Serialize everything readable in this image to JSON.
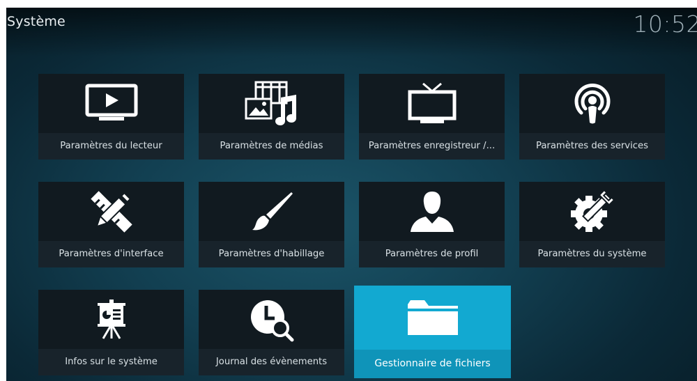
{
  "header": {
    "title": "Système",
    "clock": "10:52"
  },
  "tiles": [
    {
      "label": "Paramètres du lecteur",
      "icon": "monitor-play-icon"
    },
    {
      "label": "Paramètres de médias",
      "icon": "media-icon"
    },
    {
      "label": "Paramètres enregistreur /...",
      "icon": "tv-icon"
    },
    {
      "label": "Paramètres des services",
      "icon": "podcast-icon"
    },
    {
      "label": "Paramètres d'interface",
      "icon": "pencil-ruler-icon"
    },
    {
      "label": "Paramètres d'habillage",
      "icon": "paintbrush-icon"
    },
    {
      "label": "Paramètres de profil",
      "icon": "user-icon"
    },
    {
      "label": "Paramètres du système",
      "icon": "gear-wrench-icon"
    },
    {
      "label": "Infos sur le système",
      "icon": "presentation-icon"
    },
    {
      "label": "Journal des évènements",
      "icon": "clock-search-icon"
    },
    {
      "label": "Gestionnaire de fichiers",
      "icon": "folder-icon",
      "selected": true
    }
  ],
  "colors": {
    "accent": "#12a9d1",
    "tile_background": "#111a20",
    "background": "#123f51"
  }
}
